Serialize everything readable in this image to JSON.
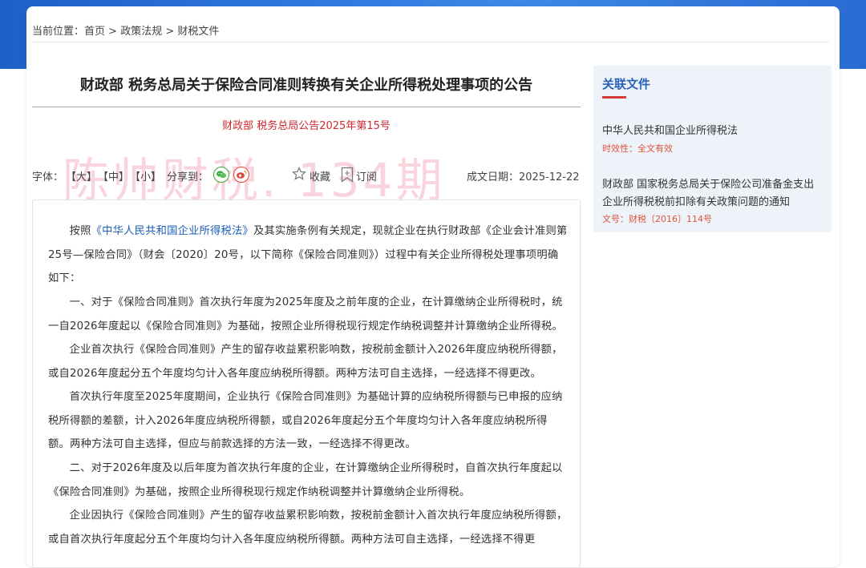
{
  "breadcrumb": {
    "prefix": "当前位置：",
    "home": "首页",
    "sep1": " > ",
    "section": "政策法规",
    "sep2": " > ",
    "current": "财税文件"
  },
  "article": {
    "title": "财政部 税务总局关于保险合同准则转换有关企业所得税处理事项的公告",
    "doc_number": "财政部 税务总局公告2025年第15号",
    "watermark": "陈帅财税. 134期"
  },
  "toolbar": {
    "font_label": "字体：",
    "font_large": "【大】",
    "font_medium": "【中】",
    "font_small": "【小】",
    "share_label": "分享到：",
    "collect_label": "收藏",
    "subscribe_label": "订阅",
    "date_label": "成文日期：2025-12-22"
  },
  "body": {
    "p1_before": "按照",
    "p1_link": "《中华人民共和国企业所得税法》",
    "p1_after": "及其实施条例有关规定，现就企业在执行财政部《企业会计准则第25号—保险合同》（财会〔2020〕20号，以下简称《保险合同准则》）过程中有关企业所得税处理事项明确如下：",
    "p2": "一、对于《保险合同准则》首次执行年度为2025年度及之前年度的企业，在计算缴纳企业所得税时，统一自2026年度起以《保险合同准则》为基础，按照企业所得税现行规定作纳税调整并计算缴纳企业所得税。",
    "p3": "企业首次执行《保险合同准则》产生的留存收益累积影响数，按税前金额计入2026年度应纳税所得额，或自2026年度起分五个年度均匀计入各年度应纳税所得额。两种方法可自主选择，一经选择不得更改。",
    "p4": "首次执行年度至2025年度期间，企业执行《保险合同准则》为基础计算的应纳税所得额与已申报的应纳税所得额的差额，计入2026年度应纳税所得额，或自2026年度起分五个年度均匀计入各年度应纳税所得额。两种方法可自主选择，但应与前款选择的方法一致，一经选择不得更改。",
    "p5": "二、对于2026年度及以后年度为首次执行年度的企业，在计算缴纳企业所得税时，自首次执行年度起以《保险合同准则》为基础，按照企业所得税现行规定作纳税调整并计算缴纳企业所得税。",
    "p6": "企业因执行《保险合同准则》产生的留存收益累积影响数，按税前金额计入首次执行年度应纳税所得额，或自首次执行年度起分五个年度均匀计入各年度应纳税所得额。两种方法可自主选择，一经选择不得更"
  },
  "sidebar": {
    "heading": "关联文件",
    "items": [
      {
        "title": "中华人民共和国企业所得税法",
        "meta": "时效性：全文有效"
      },
      {
        "title": "财政部 国家税务总局关于保险公司准备金支出企业所得税税前扣除有关政策问题的通知",
        "meta": "文号：财税〔2016〕114号"
      }
    ]
  },
  "colors": {
    "accent_blue": "#2a63b8",
    "doc_number_red": "#d0282e",
    "link_blue": "#1d5fb8",
    "header_band": "#2f78de"
  }
}
